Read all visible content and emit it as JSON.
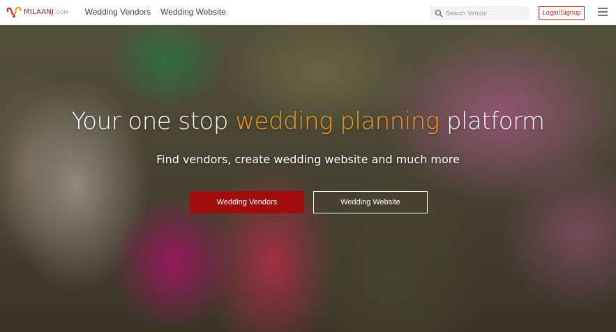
{
  "brand": {
    "name": "MILAANJ",
    "suffix": ".COM",
    "logo_icon": "heart-swirl-logo-icon",
    "brand_color": "#b71c1c",
    "logo_accent_color": "#f39a1f"
  },
  "nav": {
    "links": [
      "Wedding Vendors",
      "Wedding Website"
    ]
  },
  "search": {
    "placeholder": "Search Vendor",
    "icon": "search-icon"
  },
  "auth": {
    "login_label": "Login/Signup"
  },
  "menu": {
    "icon": "hamburger-menu-icon"
  },
  "hero": {
    "headline_before": "Your one stop ",
    "headline_accent": "wedding planning",
    "headline_after": " platform",
    "subtitle": "Find vendors, create wedding website and much more",
    "primary_button": "Wedding Vendors",
    "secondary_button": "Wedding Website",
    "accent_color": "#f39a1f",
    "primary_color": "#a00d0d"
  }
}
